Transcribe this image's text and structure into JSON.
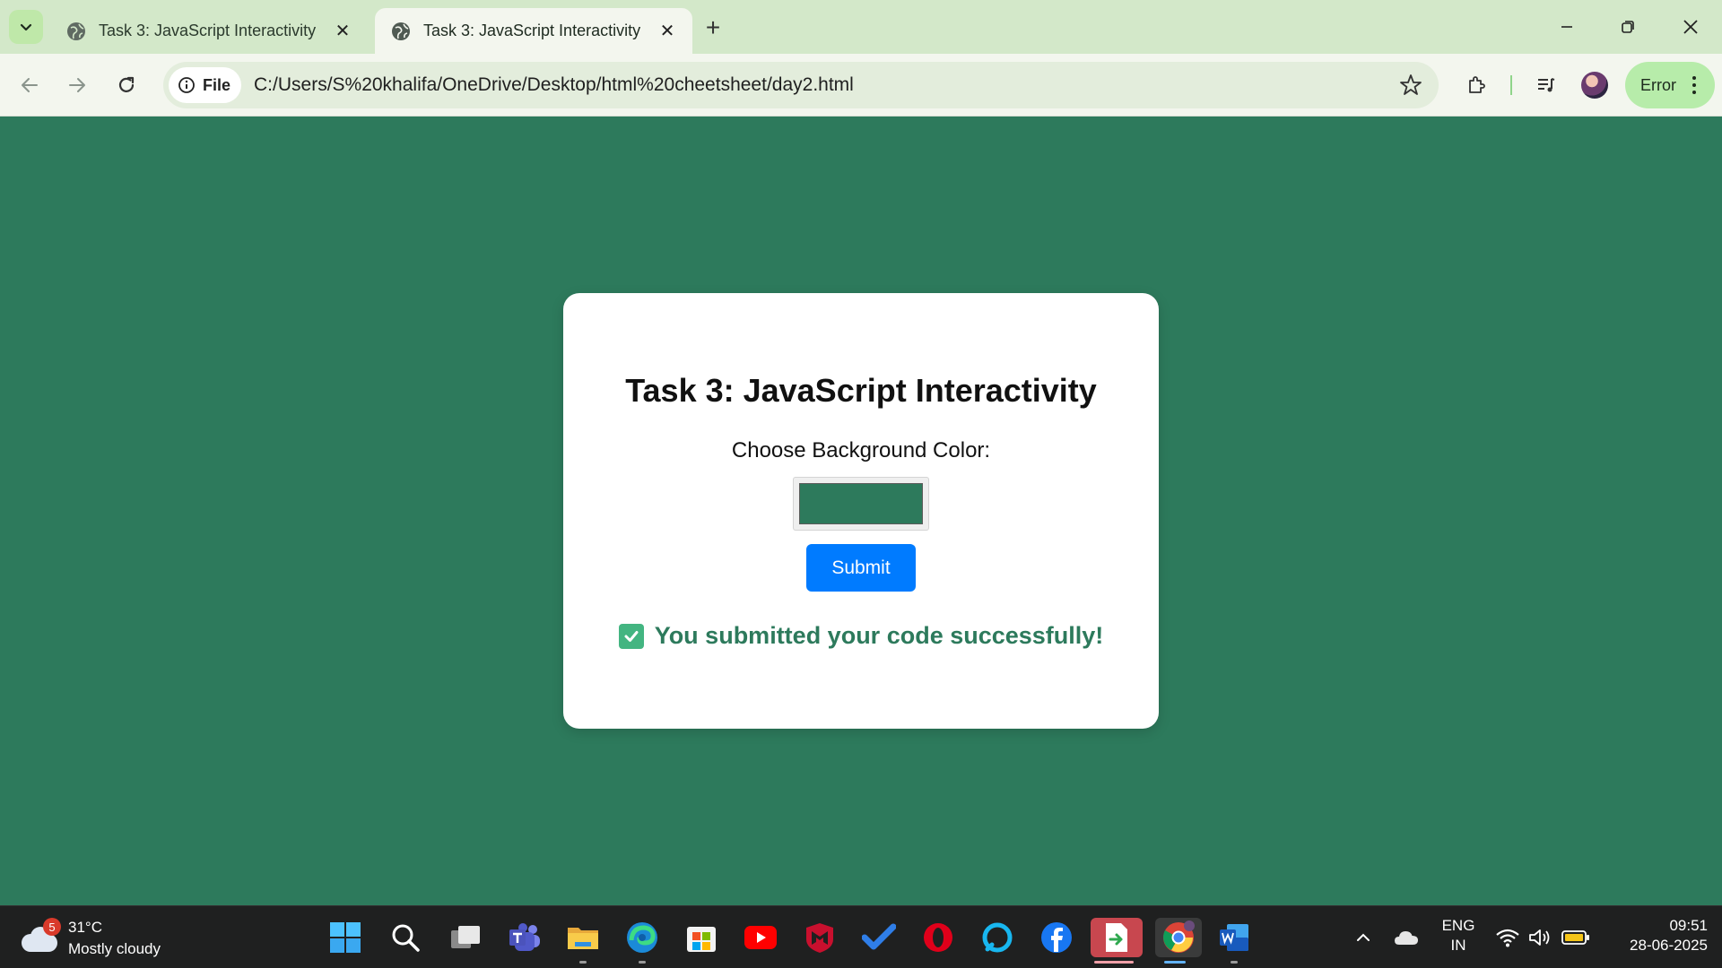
{
  "browser": {
    "tabs": [
      {
        "title": "Task 3: JavaScript Interactivity",
        "active": false
      },
      {
        "title": "Task 3: JavaScript Interactivity",
        "active": true
      }
    ],
    "new_tab_symbol": "+",
    "close_symbol": "✕",
    "address_chip": "File",
    "url": "C:/Users/S%20khalifa/OneDrive/Desktop/html%20cheetsheet/day2.html",
    "profile_status": "Error",
    "colors": {
      "titlebar": "#d3e8c9",
      "toolbar": "#f3f6ee",
      "error_pill": "#b7ecaa"
    }
  },
  "page": {
    "background_color": "#2d7a5c",
    "heading": "Task 3: JavaScript Interactivity",
    "color_label": "Choose Background Color:",
    "color_value": "#2d7a5c",
    "submit_label": "Submit",
    "success_message": "You submitted your code successfully!",
    "accent_button": "#007bff"
  },
  "taskbar": {
    "weather": {
      "badge": "5",
      "temperature": "31°C",
      "condition": "Mostly cloudy"
    },
    "apps": [
      "windows-start",
      "search",
      "task-view",
      "teams",
      "file-explorer",
      "edge",
      "microsoft-store",
      "youtube",
      "mcafee",
      "todo",
      "opera",
      "alexa",
      "facebook",
      "file-transfer",
      "chrome",
      "word"
    ],
    "language": {
      "line1": "ENG",
      "line2": "IN"
    },
    "time": "09:51",
    "date": "28-06-2025"
  }
}
